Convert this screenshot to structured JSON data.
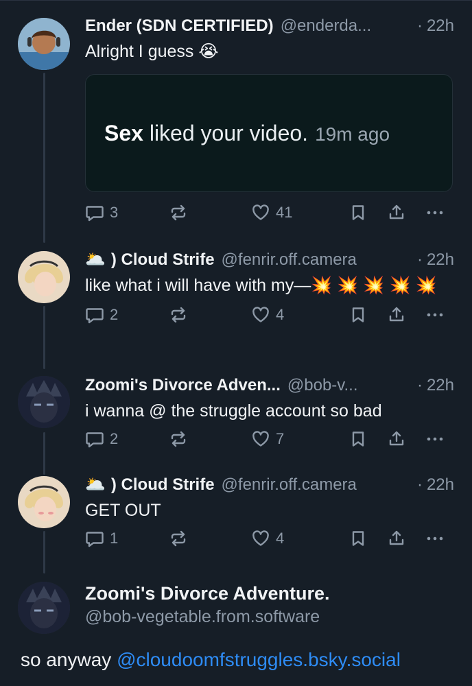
{
  "posts": [
    {
      "name": "Ender (SDN CERTIFIED)",
      "handle": "@enderda...",
      "dot": "·",
      "time": "22h",
      "text": "Alright I guess 😭",
      "embed": {
        "strong": "Sex",
        "rest": " liked your video.",
        "time": "19m ago"
      },
      "counts": {
        "replies": "3",
        "reposts": "",
        "likes": "41"
      }
    },
    {
      "emoji": "🌥️",
      "name": ") Cloud Strife",
      "handle": "@fenrir.off.camera",
      "dot": "·",
      "time": "22h",
      "text": "like what i will have with my—💥 💥 💥 💥 💥",
      "counts": {
        "replies": "2",
        "reposts": "",
        "likes": "4"
      }
    },
    {
      "name": "Zoomi's Divorce Adven...",
      "handle": "@bob-v...",
      "dot": "·",
      "time": "22h",
      "text": "i wanna @ the struggle account so bad",
      "counts": {
        "replies": "2",
        "reposts": "",
        "likes": "7"
      }
    },
    {
      "emoji": "🌥️",
      "name": ") Cloud Strife",
      "handle": "@fenrir.off.camera",
      "dot": "·",
      "time": "22h",
      "text": "GET OUT",
      "counts": {
        "replies": "1",
        "reposts": "",
        "likes": "4"
      }
    }
  ],
  "focused": {
    "name": "Zoomi's Divorce Adventure.",
    "handle": "@bob-vegetable.from.software",
    "text": "so anyway ",
    "mention": "@cloudoomfstruggles.bsky.social"
  },
  "colors": {
    "background": "#161e27",
    "muted": "#8d99a7",
    "link": "#2e8cf5",
    "thread_line": "#2e3947"
  }
}
